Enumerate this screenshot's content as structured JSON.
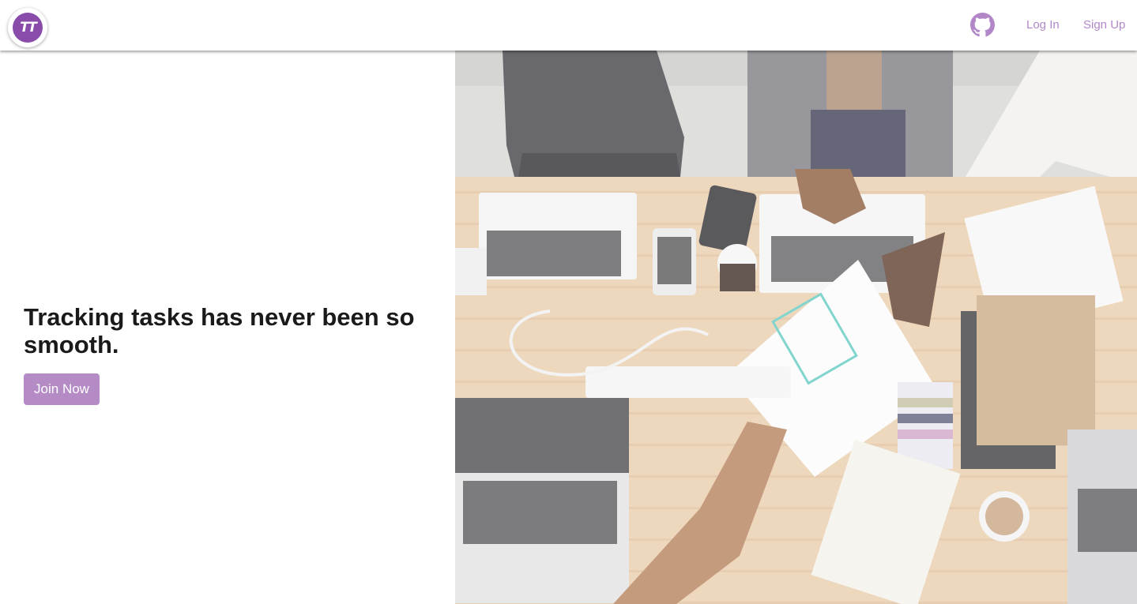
{
  "navbar": {
    "logo_text": "TT",
    "logo_icon": "tt-logo-icon",
    "github_icon": "github-icon",
    "login_label": "Log In",
    "signup_label": "Sign Up"
  },
  "hero": {
    "headline": "Tracking tasks has never been so smooth.",
    "join_label": "Join Now",
    "image": "team-working-on-laptops-at-wooden-table-photo"
  },
  "colors": {
    "brand": "#8a4cab",
    "nav_link": "#b287c8",
    "button": "#b58bc6",
    "headline": "#1a1a1a"
  }
}
